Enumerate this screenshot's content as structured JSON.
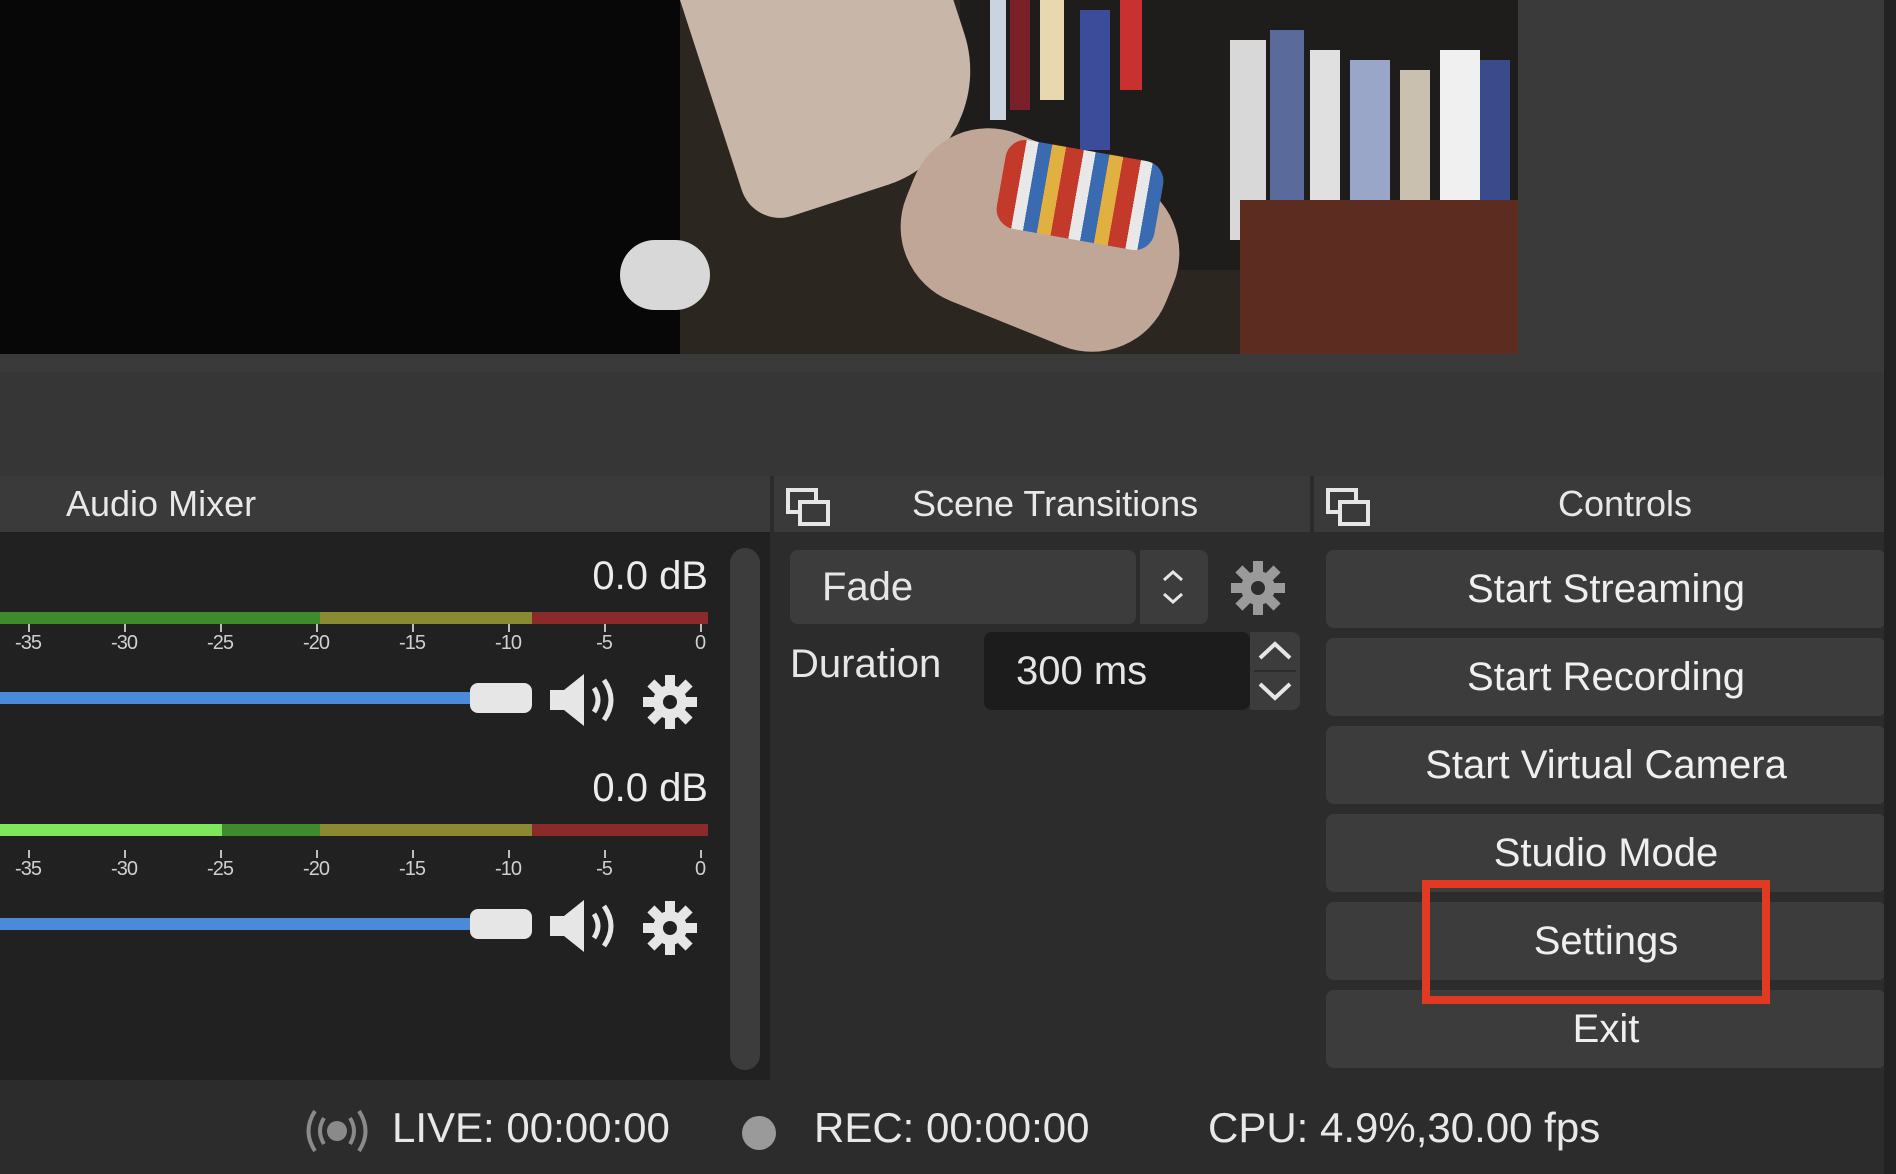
{
  "docks": {
    "audio_mixer": {
      "title": "Audio Mixer",
      "channels": [
        {
          "db": "0.0 dB",
          "level": 0.0,
          "volume": 1.0
        },
        {
          "db": "0.0 dB",
          "level": 0.31,
          "volume": 1.0
        }
      ],
      "tick_labels": [
        "-35",
        "-30",
        "-25",
        "-20",
        "-15",
        "-10",
        "-5",
        "0"
      ]
    },
    "scene_transitions": {
      "title": "Scene Transitions",
      "transition": "Fade",
      "duration_label": "Duration",
      "duration_value": "300 ms"
    },
    "controls": {
      "title": "Controls",
      "buttons": {
        "start_streaming": "Start Streaming",
        "start_recording": "Start Recording",
        "start_virtual_camera": "Start Virtual Camera",
        "studio_mode": "Studio Mode",
        "settings": "Settings",
        "exit": "Exit"
      }
    }
  },
  "status_bar": {
    "live": "LIVE: 00:00:00",
    "rec": "REC: 00:00:00",
    "cpu": "CPU: 4.9%,30.00 fps"
  },
  "colors": {
    "highlight": "#e23a22",
    "slider": "#4a8ad8",
    "meter_green": "#3f8a2c",
    "meter_green_active": "#7ee85a",
    "meter_yellow": "#8a8a32",
    "meter_red": "#8a2a2a"
  },
  "icons": [
    "popout-icon",
    "speaker-icon",
    "gear-icon",
    "updown-chevron-icon",
    "broadcast-icon",
    "record-dot-icon"
  ]
}
